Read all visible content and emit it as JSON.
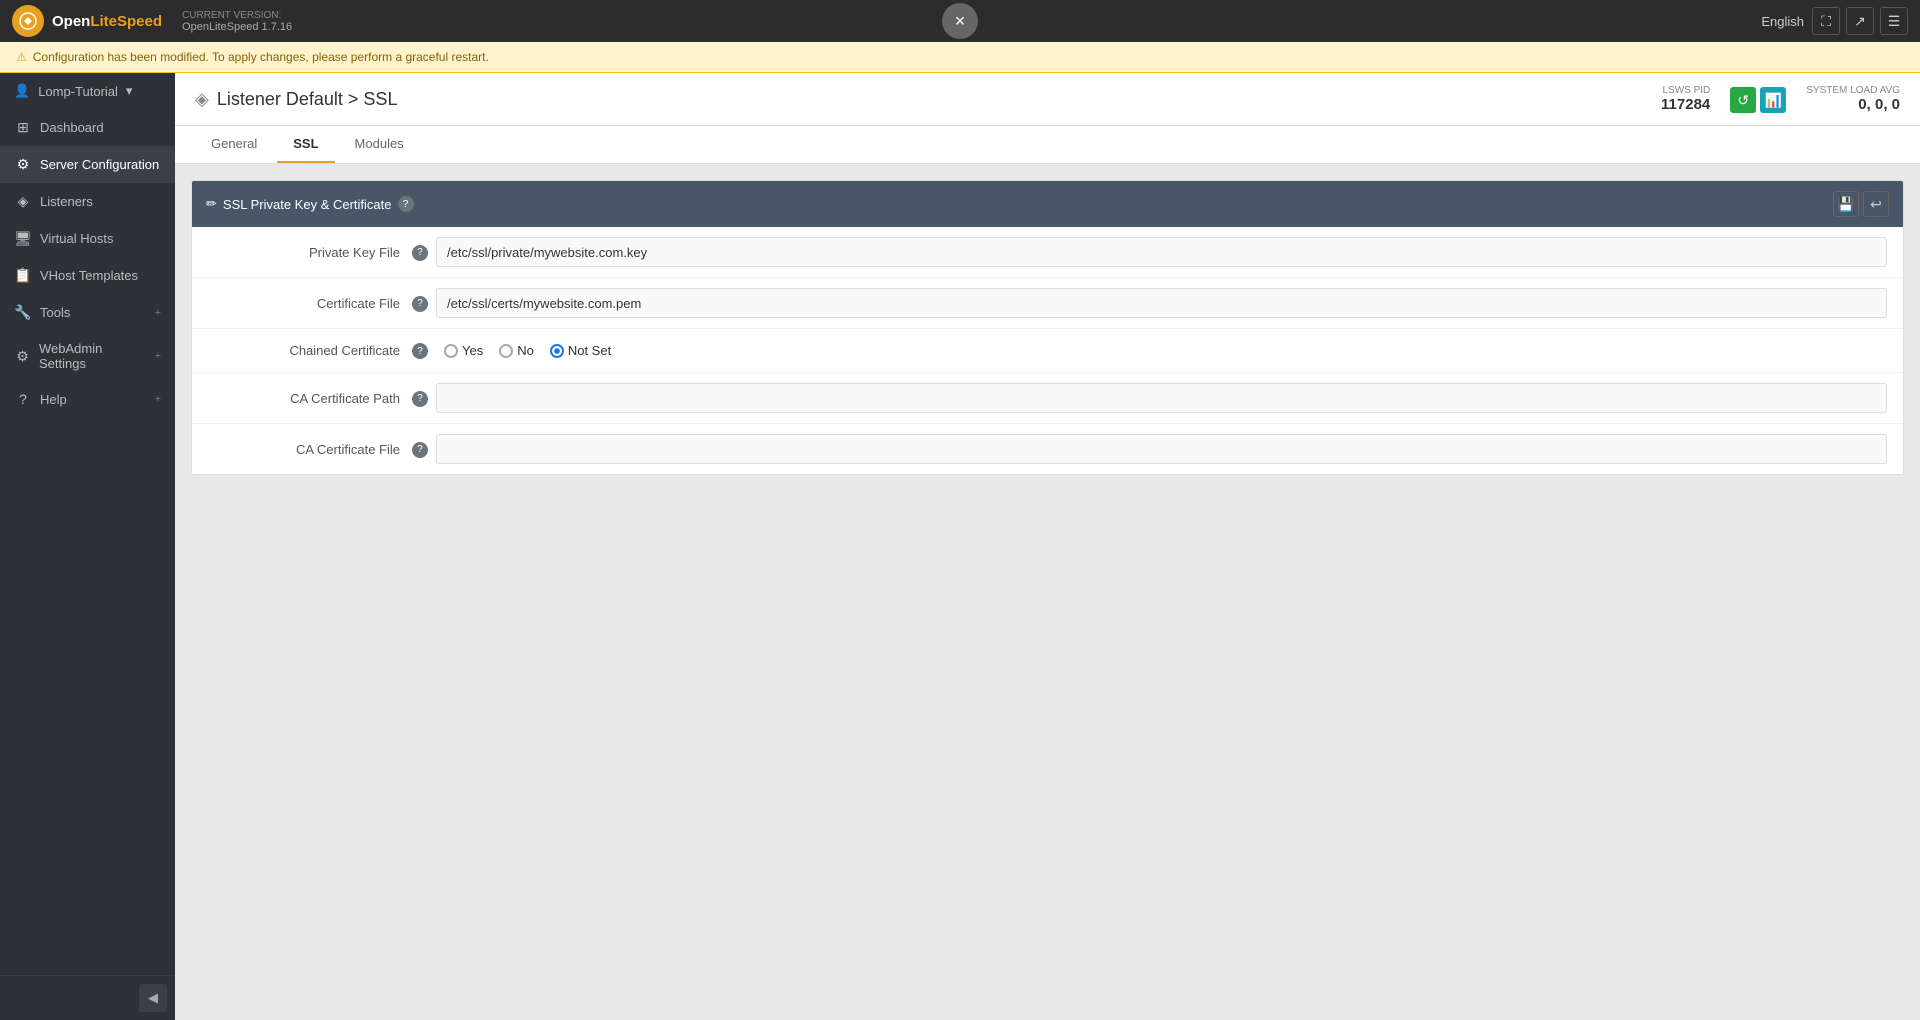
{
  "topbar": {
    "logo_text": "OpenLiteSpeed",
    "logo_letter": "O",
    "version_label": "CURRENT VERSION:",
    "version_value": "OpenLiteSpeed 1.7.16",
    "lang": "English",
    "close_btn": "×"
  },
  "notification": {
    "text": "Configuration has been modified. To apply changes, please perform a graceful restart."
  },
  "sidebar": {
    "profile": "Lomp-Tutorial",
    "items": [
      {
        "id": "dashboard",
        "label": "Dashboard",
        "icon": "⊞"
      },
      {
        "id": "server-config",
        "label": "Server Configuration",
        "icon": "⚙",
        "active": true
      },
      {
        "id": "listeners",
        "label": "Listeners",
        "icon": "◈"
      },
      {
        "id": "virtual-hosts",
        "label": "Virtual Hosts",
        "icon": "🖥"
      },
      {
        "id": "vhost-templates",
        "label": "VHost Templates",
        "icon": "📋"
      },
      {
        "id": "tools",
        "label": "Tools",
        "icon": "🔧",
        "has_expand": true
      },
      {
        "id": "webadmin",
        "label": "WebAdmin Settings",
        "icon": "⚙",
        "has_expand": true
      },
      {
        "id": "help",
        "label": "Help",
        "icon": "?",
        "has_expand": true
      }
    ]
  },
  "header": {
    "title": "Listener Default > SSL",
    "title_icon": "◈",
    "lsws_pid_label": "LSWS PID",
    "lsws_pid_value": "117284",
    "load_label": "SYSTEM LOAD AVG",
    "load_value": "0, 0, 0"
  },
  "tabs": [
    {
      "id": "general",
      "label": "General",
      "active": false
    },
    {
      "id": "ssl",
      "label": "SSL",
      "active": true
    },
    {
      "id": "modules",
      "label": "Modules",
      "active": false
    }
  ],
  "ssl_section": {
    "title": "SSL Private Key & Certificate",
    "fields": [
      {
        "id": "private-key-file",
        "label": "Private Key File",
        "type": "text",
        "value": "/etc/ssl/private/mywebsite.com.key"
      },
      {
        "id": "certificate-file",
        "label": "Certificate File",
        "type": "text",
        "value": "/etc/ssl/certs/mywebsite.com.pem"
      },
      {
        "id": "chained-certificate",
        "label": "Chained Certificate",
        "type": "radio",
        "options": [
          "Yes",
          "No",
          "Not Set"
        ],
        "selected": "Not Set"
      },
      {
        "id": "ca-certificate-path",
        "label": "CA Certificate Path",
        "type": "text",
        "value": ""
      },
      {
        "id": "ca-certificate-file",
        "label": "CA Certificate File",
        "type": "text",
        "value": ""
      }
    ]
  }
}
